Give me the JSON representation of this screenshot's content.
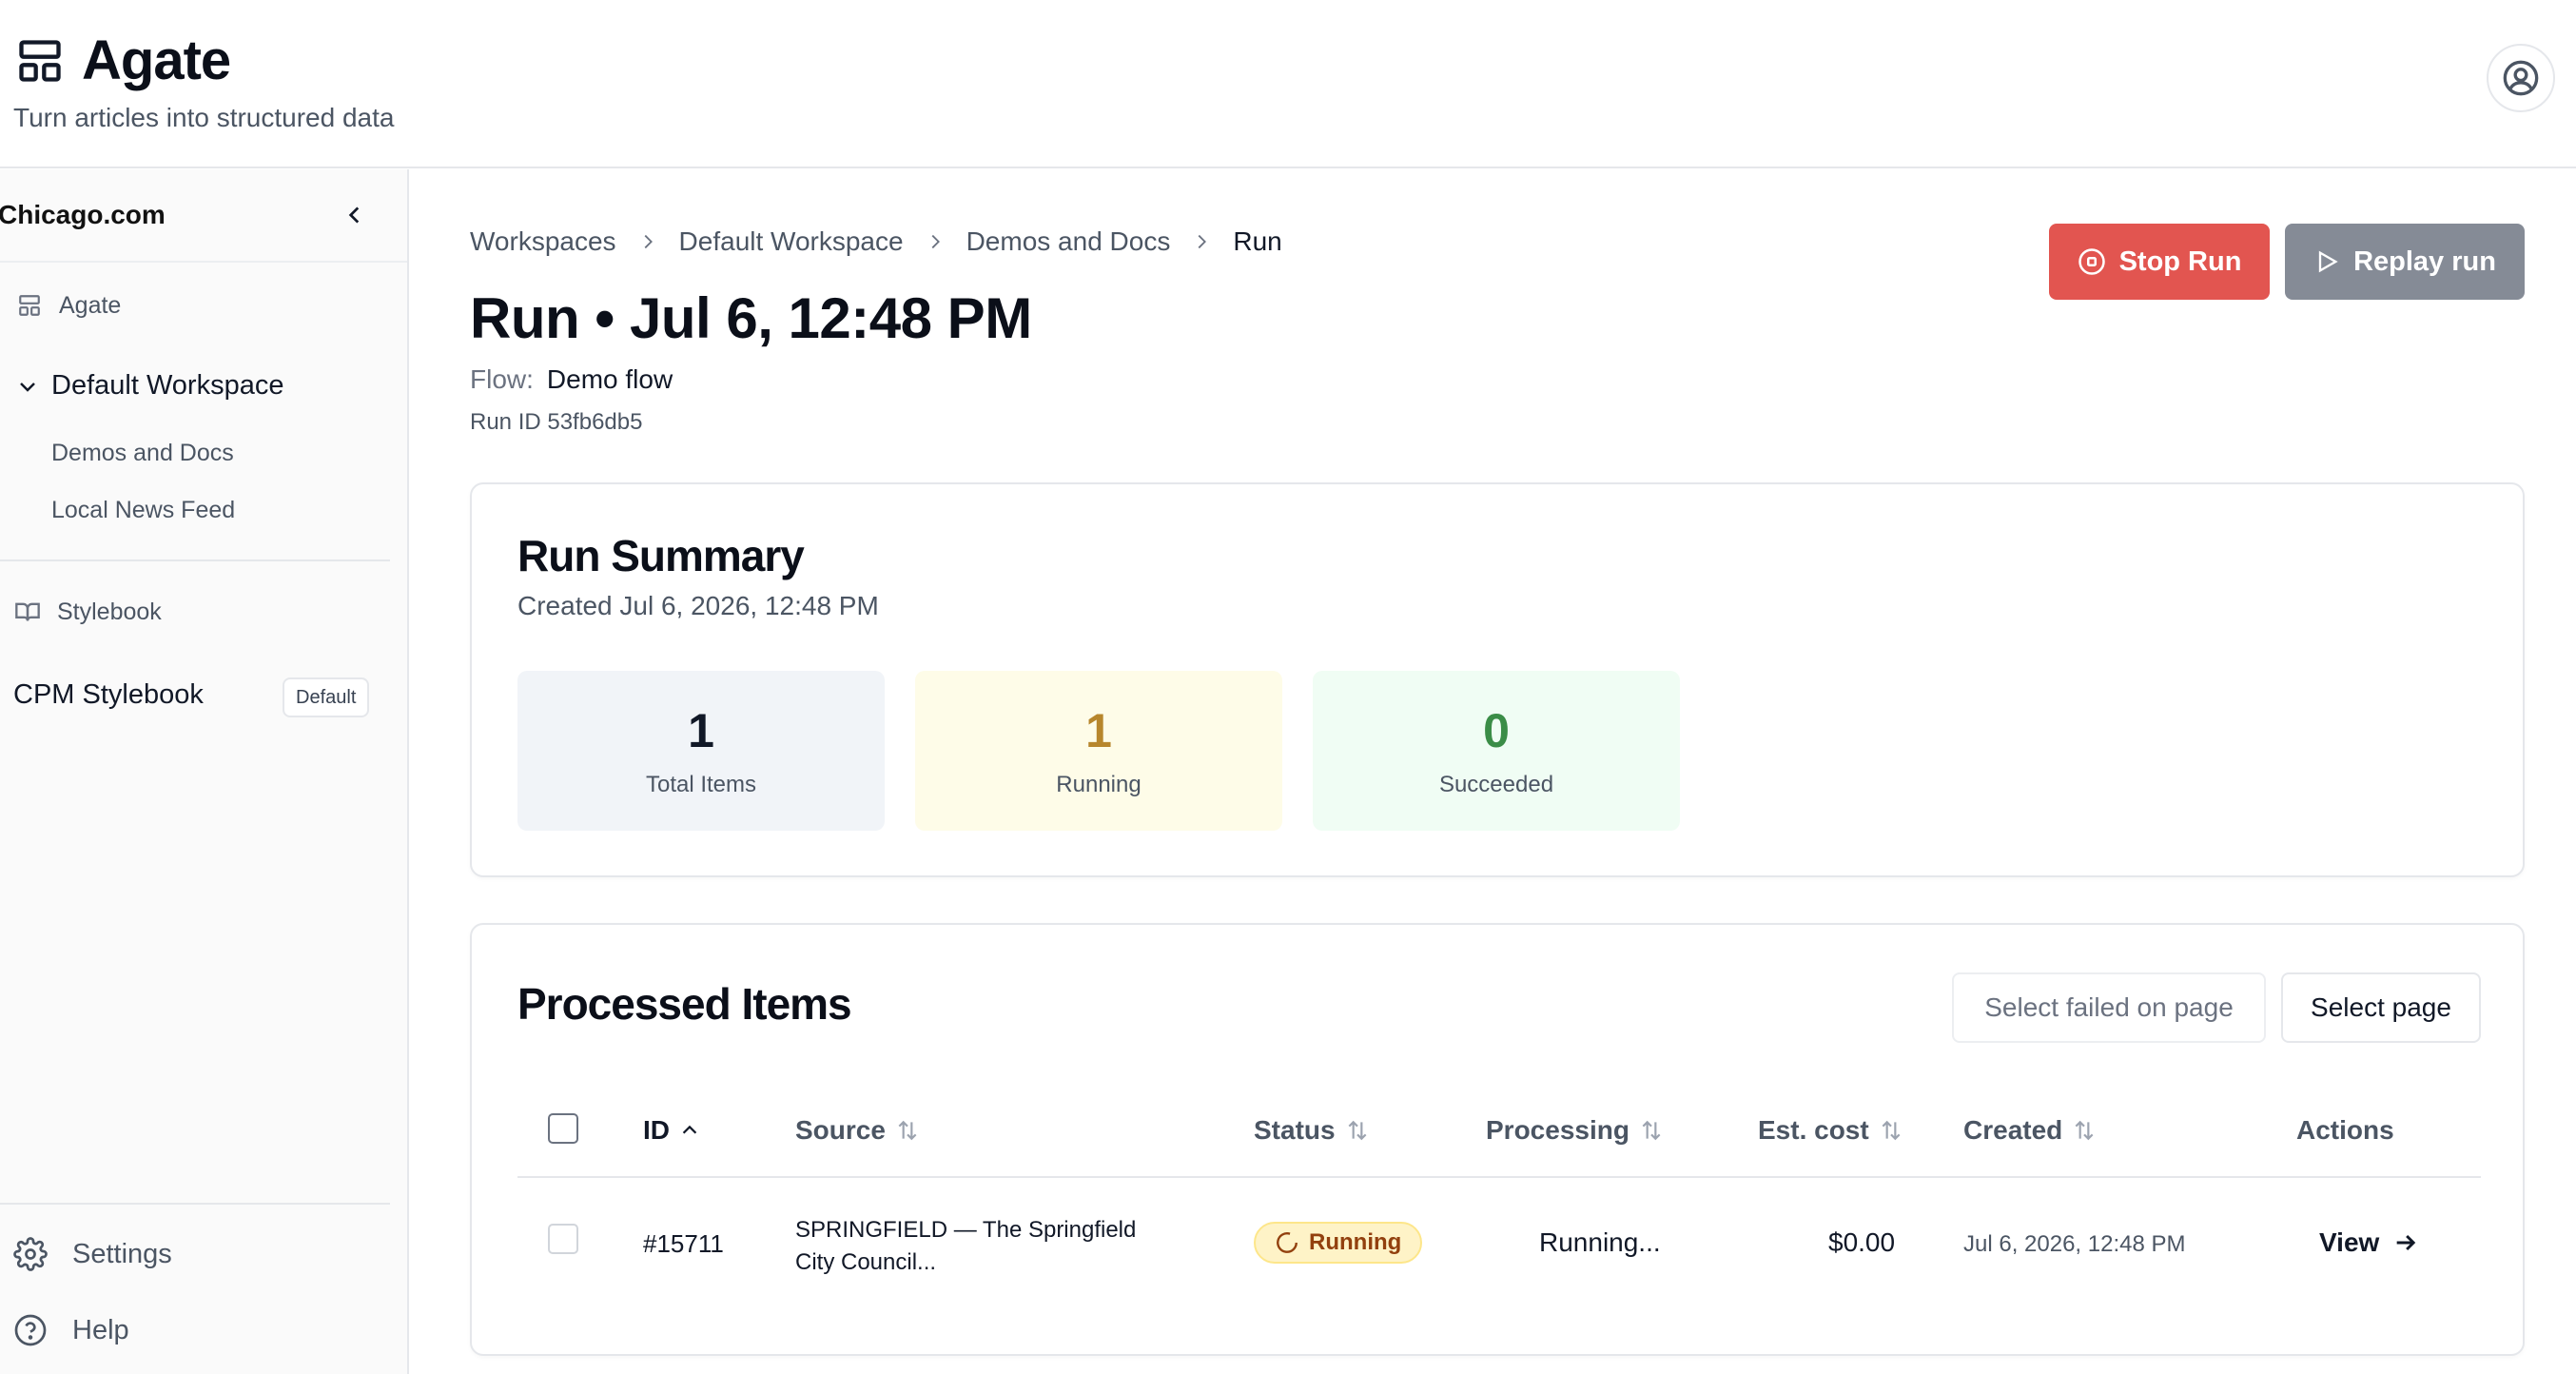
{
  "header": {
    "title": "Agate",
    "subtitle": "Turn articles into structured data"
  },
  "sidebar": {
    "org_name": "Chicago.com",
    "agate_label": "Agate",
    "workspace_label": "Default Workspace",
    "workspace_items": [
      "Demos and Docs",
      "Local News Feed"
    ],
    "stylebook_label": "Stylebook",
    "stylebook_name": "CPM Stylebook",
    "stylebook_badge": "Default",
    "settings_label": "Settings",
    "help_label": "Help"
  },
  "breadcrumb": [
    "Workspaces",
    "Default Workspace",
    "Demos and Docs",
    "Run"
  ],
  "page": {
    "title": "Run • Jul 6, 12:48 PM",
    "flow_label": "Flow:",
    "flow_name": "Demo flow",
    "run_id": "Run ID 53fb6db5"
  },
  "actions": {
    "stop_label": "Stop Run",
    "replay_label": "Replay run"
  },
  "summary": {
    "title": "Run Summary",
    "created": "Created Jul 6, 2026, 12:48 PM",
    "stats": [
      {
        "value": "1",
        "label": "Total Items",
        "color": "#111827",
        "bg": "#f1f4f8"
      },
      {
        "value": "1",
        "label": "Running",
        "color": "#b7862c",
        "bg": "#fefce8"
      },
      {
        "value": "0",
        "label": "Succeeded",
        "color": "#3b8d47",
        "bg": "#f0fdf4"
      }
    ]
  },
  "items": {
    "title": "Processed Items",
    "select_failed_label": "Select failed on page",
    "select_page_label": "Select page",
    "columns": [
      "ID",
      "Source",
      "Status",
      "Processing",
      "Est. cost",
      "Created",
      "Actions"
    ],
    "rows": [
      {
        "id": "#15711",
        "source_line1": "SPRINGFIELD — The Springfield",
        "source_line2": "City Council...",
        "status": "Running",
        "processing": "Running...",
        "cost": "$0.00",
        "created": "Jul 6, 2026, 12:48 PM",
        "action": "View"
      }
    ]
  },
  "colors": {
    "stop_button": "#e25550",
    "replay_button": "#858b96",
    "status_running_bg": "#fef3c7"
  }
}
